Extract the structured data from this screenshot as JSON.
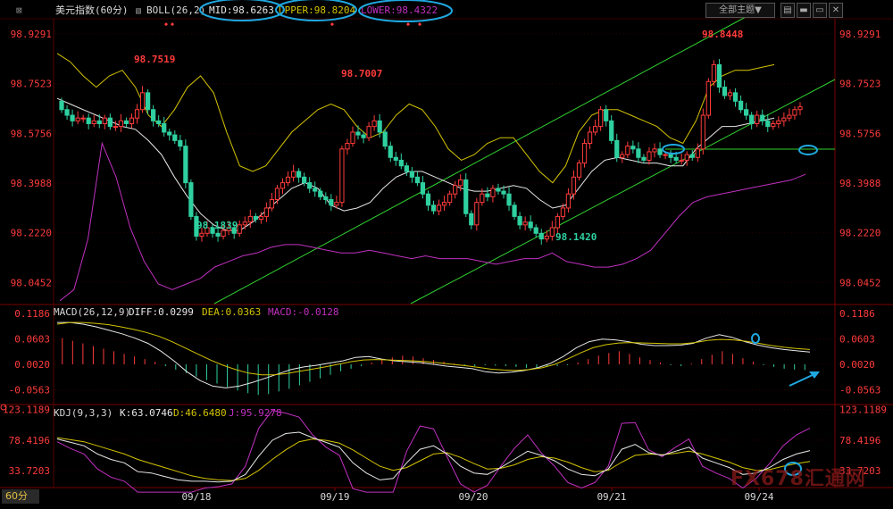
{
  "header": {
    "symbol": "美元指数(60分)",
    "boll_label": "BOLL(26,2)",
    "mid": "MID:98.6263",
    "upper": "UPPER:98.8204",
    "lower": "LOWER:98.4322",
    "theme_button": "全部主题▼"
  },
  "macd_header": {
    "name": "MACD(26,12,9)",
    "diff": "DIFF:0.0299",
    "dea": "DEA:0.0363",
    "macd": "MACD:-0.0128"
  },
  "kdj_header": {
    "name": "KDJ(9,3,3)",
    "k": "K:63.0746",
    "d": "D:46.6480",
    "j": "J:95.9278"
  },
  "period_label": "60分",
  "watermark": "FX678汇通网",
  "colors": {
    "up": "#ff3b3b",
    "down": "#2fd0a0",
    "mid": "#e8e8e8",
    "upper": "#d4c400",
    "lower": "#c030c0",
    "trend": "#30d030",
    "highlight": "#1fa8e0"
  },
  "chart_data": [
    {
      "type": "candlestick",
      "name": "price",
      "x": [
        "09/18",
        "09/19",
        "09/20",
        "09/21",
        "09/24"
      ],
      "y_ticks": [
        "98.9291",
        "98.7523",
        "98.5756",
        "98.3988",
        "98.2220",
        "98.0452"
      ],
      "ylim": [
        97.97,
        98.98
      ],
      "annotations": [
        {
          "label": "98.7519",
          "value": 98.7519
        },
        {
          "label": "98.1839",
          "value": 98.1839
        },
        {
          "label": "98.7007",
          "value": 98.7007
        },
        {
          "label": "98.1420",
          "value": 98.142
        },
        {
          "label": "98.8448",
          "value": 98.8448
        }
      ],
      "closes": [
        98.66,
        98.64,
        98.62,
        98.63,
        98.63,
        98.61,
        98.62,
        98.61,
        98.63,
        98.6,
        98.6,
        98.62,
        98.61,
        98.63,
        98.66,
        98.72,
        98.66,
        98.62,
        98.61,
        98.58,
        98.57,
        98.55,
        98.53,
        98.4,
        98.28,
        98.21,
        98.22,
        98.24,
        98.22,
        98.21,
        98.23,
        98.24,
        98.22,
        98.25,
        98.26,
        98.28,
        98.27,
        98.28,
        98.31,
        98.34,
        98.38,
        98.4,
        98.42,
        98.44,
        98.42,
        98.4,
        98.38,
        98.37,
        98.35,
        98.34,
        98.32,
        98.33,
        98.52,
        98.54,
        98.58,
        98.57,
        98.56,
        98.6,
        98.62,
        98.58,
        98.53,
        98.49,
        98.48,
        98.46,
        98.44,
        98.42,
        98.4,
        98.36,
        98.32,
        98.3,
        98.32,
        98.33,
        98.36,
        98.39,
        98.41,
        98.29,
        98.25,
        98.33,
        98.36,
        98.35,
        98.38,
        98.37,
        98.36,
        98.32,
        98.28,
        98.25,
        98.26,
        98.24,
        98.22,
        98.2,
        98.21,
        98.24,
        98.28,
        98.31,
        98.36,
        98.42,
        98.47,
        98.54,
        98.58,
        98.6,
        98.66,
        98.62,
        98.55,
        98.49,
        98.5,
        98.53,
        98.52,
        98.49,
        98.48,
        98.51,
        98.52,
        98.5,
        98.5,
        98.49,
        98.48,
        98.48,
        98.5,
        98.49,
        98.52,
        98.64,
        98.76,
        98.82,
        98.74,
        98.71,
        98.72,
        98.69,
        98.66,
        98.64,
        98.61,
        98.64,
        98.62,
        98.6,
        98.61,
        98.62,
        98.63,
        98.64,
        98.66,
        98.67
      ],
      "mid": [
        98.7,
        98.68,
        98.66,
        98.64,
        98.62,
        98.6,
        98.59,
        98.55,
        98.5,
        98.42,
        98.35,
        98.29,
        98.25,
        98.23,
        98.23,
        98.26,
        98.3,
        98.34,
        98.38,
        98.4,
        98.38,
        98.32,
        98.3,
        98.31,
        98.33,
        98.38,
        98.42,
        98.44,
        98.44,
        98.42,
        98.4,
        98.38,
        98.37,
        98.37,
        98.38,
        98.39,
        98.38,
        98.34,
        98.31,
        98.32,
        98.38,
        98.44,
        98.48,
        98.49,
        98.48,
        98.47,
        98.47,
        98.46,
        98.46,
        98.52,
        98.56,
        98.6,
        98.6,
        98.61,
        98.62,
        98.63
      ],
      "upper": [
        98.86,
        98.83,
        98.78,
        98.74,
        98.78,
        98.8,
        98.74,
        98.64,
        98.6,
        98.66,
        98.74,
        98.78,
        98.72,
        98.58,
        98.46,
        98.44,
        98.46,
        98.52,
        98.58,
        98.62,
        98.66,
        98.68,
        98.66,
        98.6,
        98.56,
        98.58,
        98.64,
        98.68,
        98.66,
        98.6,
        98.52,
        98.48,
        98.5,
        98.54,
        98.56,
        98.56,
        98.5,
        98.44,
        98.4,
        98.46,
        98.58,
        98.64,
        98.66,
        98.66,
        98.64,
        98.62,
        98.6,
        98.56,
        98.54,
        98.62,
        98.74,
        98.78,
        98.8,
        98.8,
        98.81,
        98.82
      ],
      "lower": [
        97.98,
        98.02,
        98.2,
        98.54,
        98.42,
        98.24,
        98.12,
        98.04,
        98.02,
        98.04,
        98.06,
        98.1,
        98.12,
        98.14,
        98.15,
        98.17,
        98.18,
        98.18,
        98.17,
        98.16,
        98.15,
        98.15,
        98.16,
        98.15,
        98.14,
        98.13,
        98.14,
        98.13,
        98.13,
        98.13,
        98.12,
        98.11,
        98.12,
        98.13,
        98.13,
        98.15,
        98.12,
        98.11,
        98.1,
        98.1,
        98.11,
        98.13,
        98.16,
        98.22,
        98.28,
        98.33,
        98.35,
        98.36,
        98.37,
        98.38,
        98.39,
        98.4,
        98.41,
        98.43
      ]
    },
    {
      "type": "bar",
      "name": "MACD",
      "y_ticks": [
        "0.1186",
        "0.0603",
        "0.0020",
        "-0.0563"
      ],
      "ylim": [
        -0.088,
        0.135
      ],
      "histogram": [
        0.06,
        0.054,
        0.048,
        0.042,
        0.036,
        0.03,
        0.024,
        0.018,
        0.012,
        0.006,
        -0.004,
        -0.012,
        -0.02,
        -0.028,
        -0.036,
        -0.044,
        -0.052,
        -0.06,
        -0.066,
        -0.07,
        -0.068,
        -0.062,
        -0.056,
        -0.048,
        -0.04,
        -0.032,
        -0.024,
        -0.016,
        -0.01,
        -0.004,
        0.004,
        0.01,
        0.016,
        0.02,
        0.018,
        0.014,
        0.01,
        0.006,
        0.002,
        -0.002,
        -0.004,
        -0.002,
        -0.003,
        -0.004,
        -0.006,
        -0.008,
        -0.008,
        -0.006,
        -0.004,
        -0.002,
        0.004,
        0.012,
        0.02,
        0.026,
        0.03,
        0.024,
        0.016,
        0.01,
        0.004,
        -0.002,
        -0.004,
        0.002,
        0.012,
        0.022,
        0.03,
        0.024,
        0.014,
        0.006,
        -0.002,
        -0.006,
        -0.01,
        -0.012,
        -0.013
      ],
      "diff": [
        0.098,
        0.098,
        0.094,
        0.088,
        0.08,
        0.072,
        0.062,
        0.05,
        0.032,
        0.01,
        -0.015,
        -0.035,
        -0.048,
        -0.052,
        -0.048,
        -0.04,
        -0.03,
        -0.02,
        -0.01,
        -0.004,
        0.0,
        0.005,
        0.01,
        0.018,
        0.02,
        0.014,
        0.01,
        0.008,
        0.006,
        0.002,
        -0.002,
        -0.005,
        -0.008,
        -0.015,
        -0.018,
        -0.016,
        -0.012,
        -0.006,
        0.004,
        0.02,
        0.04,
        0.054,
        0.06,
        0.058,
        0.054,
        0.048,
        0.045,
        0.045,
        0.046,
        0.05,
        0.062,
        0.07,
        0.064,
        0.054,
        0.046,
        0.04,
        0.036,
        0.033,
        0.03
      ],
      "dea": [
        0.094,
        0.098,
        0.098,
        0.096,
        0.093,
        0.088,
        0.082,
        0.075,
        0.066,
        0.054,
        0.04,
        0.026,
        0.012,
        0.0,
        -0.01,
        -0.018,
        -0.022,
        -0.022,
        -0.019,
        -0.014,
        -0.009,
        -0.004,
        0.002,
        0.008,
        0.012,
        0.013,
        0.012,
        0.011,
        0.01,
        0.008,
        0.005,
        0.002,
        -0.001,
        -0.005,
        -0.009,
        -0.011,
        -0.012,
        -0.01,
        -0.006,
        0.002,
        0.014,
        0.028,
        0.04,
        0.047,
        0.051,
        0.052,
        0.051,
        0.05,
        0.049,
        0.049,
        0.052,
        0.057,
        0.059,
        0.058,
        0.055,
        0.05,
        0.045,
        0.041,
        0.038,
        0.036
      ]
    },
    {
      "type": "line",
      "name": "KDJ",
      "y_ticks": [
        "123.1189",
        "78.4196",
        "33.7203"
      ],
      "ylim": [
        10.0,
        128.0
      ],
      "k": [
        80,
        75,
        70,
        58,
        50,
        45,
        32,
        30,
        25,
        20,
        18,
        18,
        17,
        18,
        28,
        55,
        78,
        88,
        90,
        82,
        75,
        68,
        45,
        30,
        20,
        22,
        45,
        65,
        70,
        58,
        40,
        30,
        28,
        38,
        50,
        62,
        56,
        48,
        36,
        28,
        26,
        36,
        65,
        72,
        60,
        56,
        62,
        68,
        52,
        45,
        38,
        28,
        30,
        38,
        50,
        58,
        63
      ],
      "d": [
        82,
        79,
        76,
        70,
        64,
        58,
        50,
        44,
        38,
        32,
        26,
        22,
        20,
        19,
        22,
        34,
        50,
        64,
        76,
        80,
        78,
        74,
        64,
        52,
        40,
        34,
        38,
        48,
        58,
        60,
        53,
        44,
        36,
        37,
        42,
        50,
        54,
        52,
        46,
        38,
        32,
        34,
        46,
        56,
        58,
        57,
        59,
        62,
        58,
        52,
        46,
        38,
        34,
        35,
        40,
        44,
        47
      ],
      "j": [
        76,
        66,
        58,
        36,
        24,
        18,
        2,
        2,
        2,
        2,
        2,
        8,
        10,
        14,
        40,
        96,
        122,
        118,
        112,
        86,
        68,
        56,
        7,
        2,
        2,
        2,
        62,
        99,
        95,
        54,
        14,
        2,
        12,
        40,
        66,
        86,
        60,
        40,
        16,
        8,
        16,
        40,
        103,
        104,
        64,
        54,
        68,
        80,
        40,
        30,
        22,
        8,
        22,
        44,
        70,
        86,
        96
      ]
    }
  ]
}
